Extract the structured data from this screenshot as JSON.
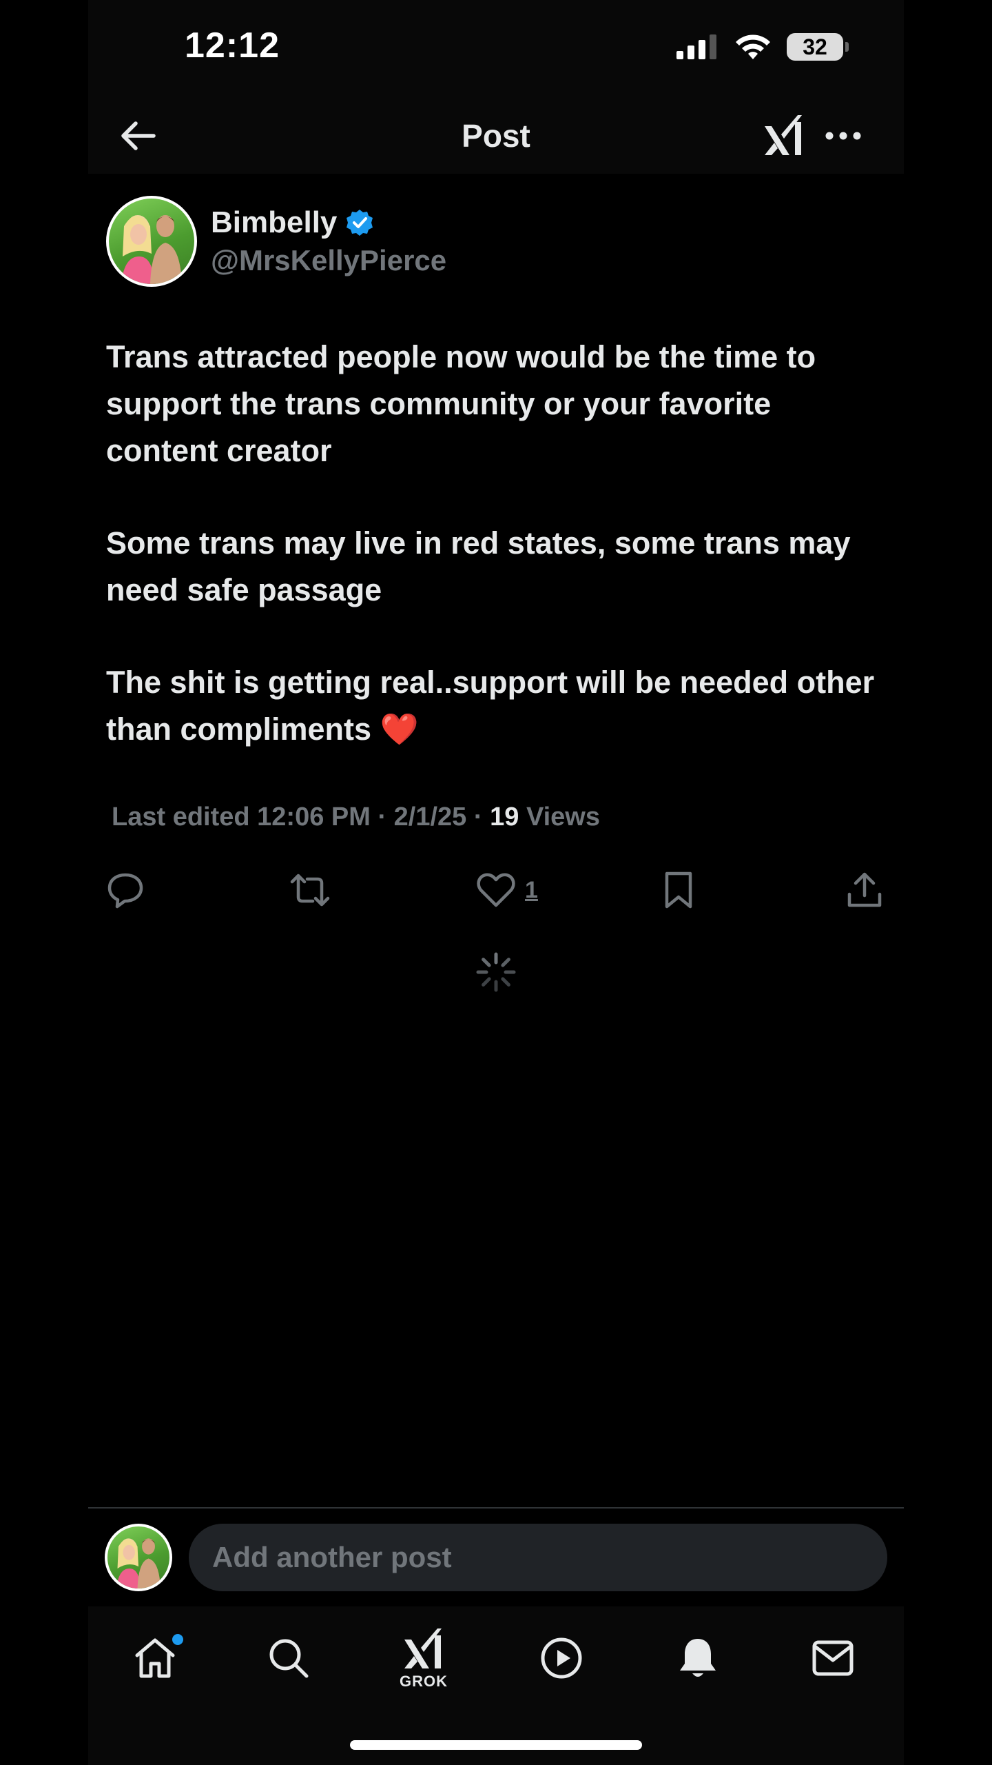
{
  "status_bar": {
    "time": "12:12",
    "battery": "32"
  },
  "header": {
    "title": "Post"
  },
  "post": {
    "author_name": "Bimbelly",
    "author_handle": "@MrsKellyPierce",
    "paragraphs": [
      "Trans attracted people now would be the time to support the trans community or your favorite content creator",
      "Some trans  may live in red states, some trans may need safe passage",
      "The shit is getting real..support will be needed other than compliments ❤️"
    ],
    "edited_label": "Last edited 12:06 PM · 2/1/25",
    "views_sep": " · ",
    "views_count": "19",
    "views_label": " Views"
  },
  "actions": {
    "like_count": "1"
  },
  "composer": {
    "placeholder": "Add another post"
  },
  "nav": {
    "grok_label": "GROK"
  },
  "colors": {
    "background": "#000000",
    "text": "#e7e9ea",
    "secondary": "#71767b",
    "accent": "#1d9bf0",
    "heart": "#f91880"
  },
  "icons": [
    "back-arrow-icon",
    "grok-icon",
    "more-icon",
    "verified-badge-icon",
    "reply-icon",
    "repost-icon",
    "like-icon",
    "bookmark-icon",
    "share-icon",
    "loading-spinner-icon",
    "home-icon",
    "search-icon",
    "play-icon",
    "bell-icon",
    "mail-icon"
  ]
}
